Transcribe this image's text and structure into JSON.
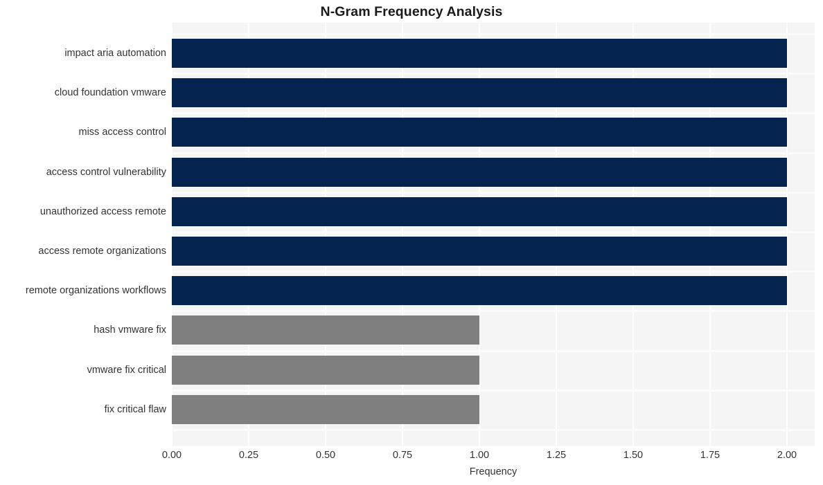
{
  "chart_data": {
    "type": "bar",
    "orientation": "horizontal",
    "title": "N-Gram Frequency Analysis",
    "xlabel": "Frequency",
    "ylabel": "",
    "categories": [
      "impact aria automation",
      "cloud foundation vmware",
      "miss access control",
      "access control vulnerability",
      "unauthorized access remote",
      "access remote organizations",
      "remote organizations workflows",
      "hash vmware fix",
      "vmware fix critical",
      "fix critical flaw"
    ],
    "values": [
      2,
      2,
      2,
      2,
      2,
      2,
      2,
      1,
      1,
      1
    ],
    "bar_colors": [
      "#04244f",
      "#04244f",
      "#04244f",
      "#04244f",
      "#04244f",
      "#04244f",
      "#04244f",
      "#7f7f7f",
      "#7f7f7f",
      "#7f7f7f"
    ],
    "xlim": [
      0.0,
      2.0
    ],
    "xticks": [
      0.0,
      0.25,
      0.5,
      0.75,
      1.0,
      1.25,
      1.5,
      1.75,
      2.0
    ],
    "xticklabels": [
      "0.00",
      "0.25",
      "0.50",
      "0.75",
      "1.00",
      "1.25",
      "1.50",
      "1.75",
      "2.00"
    ],
    "grid": true,
    "legend": null,
    "plot_background": "#f5f5f5",
    "figure_background": "#ffffff",
    "gridline_color": "#ffffff",
    "text_color": "#333333",
    "title_color": "#1a1a1a"
  }
}
